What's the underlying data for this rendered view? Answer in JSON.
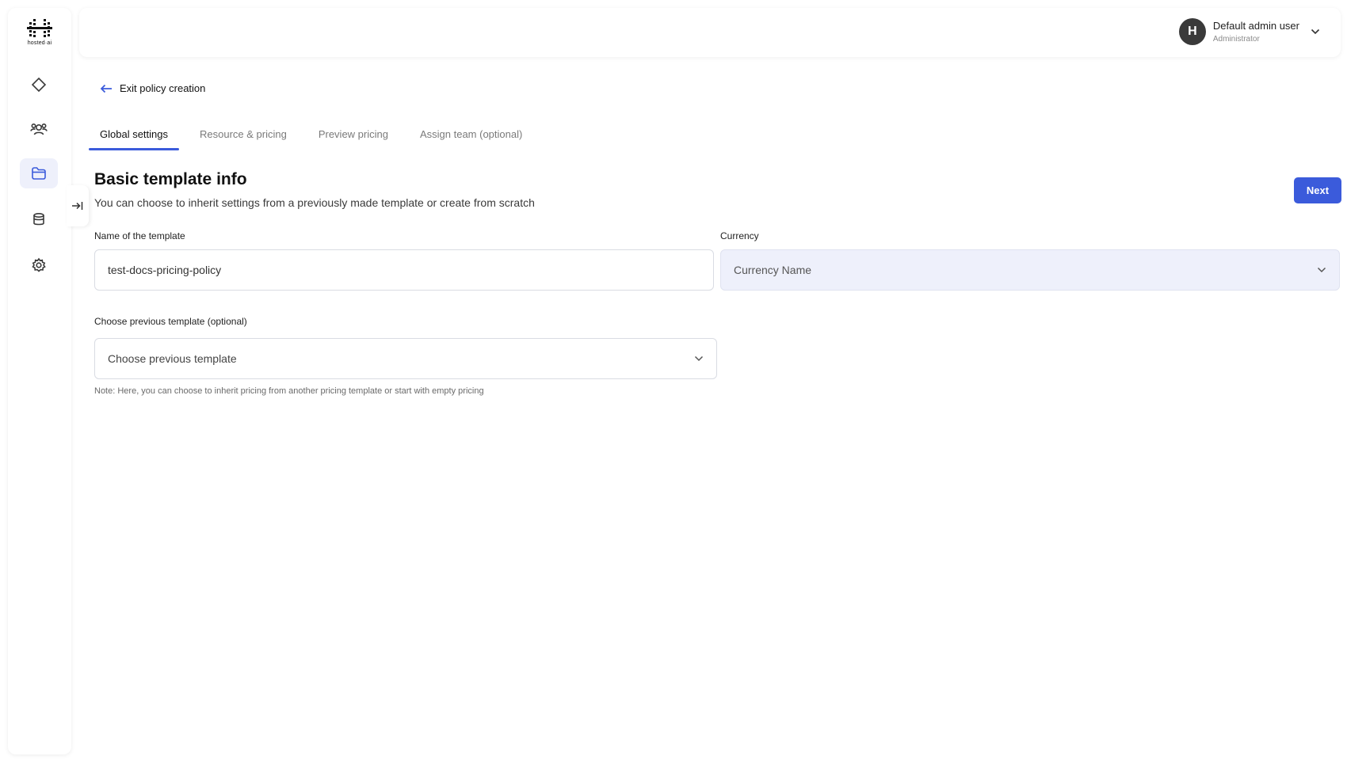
{
  "app": {
    "logo_text": "hosted·ai"
  },
  "header": {
    "user_initial": "H",
    "user_name": "Default admin user",
    "user_role": "Administrator"
  },
  "nav": {
    "back_label": "Exit policy creation"
  },
  "tabs": [
    {
      "label": "Global settings",
      "active": true
    },
    {
      "label": "Resource & pricing",
      "active": false
    },
    {
      "label": "Preview pricing",
      "active": false
    },
    {
      "label": "Assign team (optional)",
      "active": false
    }
  ],
  "section": {
    "title": "Basic template info",
    "subtitle": "You can choose to inherit settings from a previously made template or create from scratch",
    "next_label": "Next"
  },
  "form": {
    "name_label": "Name of the template",
    "name_value": "test-docs-pricing-policy",
    "currency_label": "Currency",
    "currency_placeholder": "Currency Name",
    "previous_label": "Choose previous template (optional)",
    "previous_placeholder": "Choose previous template",
    "note": "Note: Here, you can choose to inherit pricing from another pricing template or start with empty pricing"
  },
  "colors": {
    "accent": "#3b5bdb",
    "active_bg": "#eef0fb"
  }
}
